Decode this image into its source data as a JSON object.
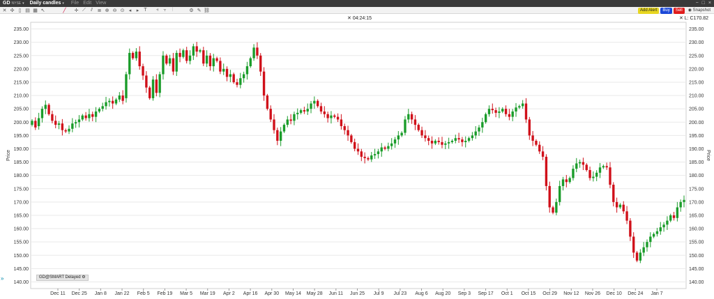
{
  "window": {
    "symbol": "GD",
    "exchange": "NYSE",
    "period": "Daily candles",
    "menus": [
      "File",
      "Edit",
      "View"
    ],
    "controls": [
      "−",
      "□",
      "×"
    ]
  },
  "toolbar": {
    "add_alert": "Add Alert",
    "buy": "Buy",
    "sell": "Sell",
    "snapshot": "Snapshot"
  },
  "overlay": {
    "cursor_time": "04:24:15",
    "last_price": "L: C170.82",
    "datasource": "GD@SMART Delayed"
  },
  "colors": {
    "up": "#1a9c2a",
    "down": "#d0101a",
    "grid": "#e9e9e9",
    "axis_text": "#333333"
  },
  "chart_data": {
    "type": "candlestick",
    "ylabel": "Price",
    "ylim": [
      137.5,
      237.5
    ],
    "yticks": [
      "140.00",
      "145.00",
      "150.00",
      "155.00",
      "160.00",
      "165.00",
      "170.00",
      "175.00",
      "180.00",
      "185.00",
      "190.00",
      "195.00",
      "200.00",
      "205.00",
      "210.00",
      "215.00",
      "220.00",
      "225.00",
      "230.00",
      "235.00"
    ],
    "xticks": [
      "Dec 11",
      "Dec 25",
      "Jan 8",
      "Jan 22",
      "Feb 5",
      "Feb 19",
      "Mar 5",
      "Mar 19",
      "Apr 2",
      "Apr 16",
      "Apr 30",
      "May 14",
      "May 28",
      "Jun 11",
      "Jun 25",
      "Jul 9",
      "Jul 23",
      "Aug 6",
      "Aug 20",
      "Sep 3",
      "Sep 17",
      "Oct 1",
      "Oct 15",
      "Oct 29",
      "Nov 12",
      "Nov 26",
      "Dec 10",
      "Dec 24",
      "Jan 7"
    ],
    "closes": [
      200.5,
      198.0,
      201.5,
      205.0,
      206.5,
      203.0,
      200.5,
      199.0,
      199.5,
      197.0,
      196.5,
      197.5,
      199.5,
      200.0,
      201.0,
      202.5,
      201.5,
      203.0,
      202.0,
      204.0,
      205.0,
      206.0,
      207.5,
      208.0,
      207.0,
      208.5,
      210.0,
      208.0,
      218.0,
      226.0,
      224.0,
      226.5,
      221.0,
      217.5,
      213.0,
      209.0,
      216.0,
      211.0,
      218.0,
      225.0,
      222.0,
      224.0,
      219.0,
      226.0,
      224.5,
      227.0,
      223.0,
      225.0,
      228.5,
      226.5,
      227.0,
      222.0,
      225.0,
      221.0,
      224.0,
      223.0,
      219.0,
      220.0,
      217.0,
      218.0,
      215.0,
      214.0,
      216.5,
      218.0,
      221.0,
      224.0,
      228.0,
      225.0,
      219.0,
      210.0,
      205.0,
      201.0,
      197.0,
      193.0,
      196.5,
      199.0,
      201.0,
      200.5,
      203.0,
      203.5,
      204.5,
      204.0,
      205.0,
      207.0,
      208.0,
      206.0,
      204.0,
      203.0,
      201.5,
      202.5,
      202.0,
      201.0,
      198.5,
      197.0,
      195.0,
      192.5,
      190.0,
      189.0,
      187.0,
      186.5,
      186.0,
      187.5,
      188.0,
      189.0,
      190.5,
      190.0,
      191.0,
      192.0,
      193.5,
      195.0,
      196.0,
      201.0,
      203.0,
      201.0,
      199.0,
      197.0,
      195.0,
      194.0,
      193.0,
      192.0,
      193.0,
      192.5,
      191.5,
      192.0,
      192.5,
      193.0,
      194.0,
      193.5,
      192.5,
      193.0,
      194.0,
      195.0,
      196.5,
      198.0,
      200.0,
      203.0,
      205.0,
      204.5,
      203.5,
      204.0,
      205.0,
      203.0,
      202.0,
      204.0,
      205.5,
      206.0,
      207.0,
      201.0,
      195.0,
      193.0,
      191.5,
      189.0,
      187.0,
      176.0,
      168.0,
      166.0,
      170.0,
      176.0,
      178.5,
      177.5,
      179.0,
      182.5,
      184.5,
      185.0,
      184.0,
      182.0,
      179.0,
      179.5,
      181.0,
      183.0,
      183.5,
      183.0,
      176.5,
      170.0,
      168.0,
      169.0,
      166.5,
      163.0,
      157.0,
      151.0,
      148.0,
      151.0,
      153.0,
      155.0,
      157.0,
      158.0,
      159.0,
      160.5,
      161.5,
      163.0,
      165.0,
      164.0,
      168.0,
      170.0,
      170.8
    ],
    "opens": [
      199.0,
      200.5,
      198.5,
      201.5,
      205.0,
      206.5,
      203.0,
      200.5,
      199.0,
      199.5,
      197.0,
      196.5,
      197.5,
      199.5,
      200.0,
      201.0,
      202.5,
      201.5,
      203.0,
      202.0,
      204.0,
      205.0,
      206.0,
      207.5,
      208.0,
      207.0,
      208.5,
      210.0,
      209.0,
      218.0,
      226.0,
      224.0,
      226.5,
      221.0,
      217.5,
      213.0,
      209.0,
      216.0,
      211.0,
      218.0,
      225.0,
      222.0,
      224.0,
      219.0,
      226.0,
      224.5,
      227.0,
      223.0,
      225.0,
      228.5,
      226.5,
      227.0,
      222.0,
      225.0,
      221.0,
      224.0,
      223.0,
      219.0,
      220.0,
      217.0,
      218.0,
      215.0,
      214.0,
      216.5,
      218.0,
      221.0,
      224.0,
      228.0,
      225.0,
      219.0,
      210.0,
      205.0,
      201.0,
      197.0,
      193.0,
      196.5,
      199.0,
      201.0,
      200.5,
      203.0,
      203.5,
      204.5,
      204.0,
      205.0,
      207.0,
      208.0,
      206.0,
      204.0,
      203.0,
      201.5,
      202.5,
      202.0,
      201.0,
      198.5,
      197.0,
      195.0,
      192.5,
      190.0,
      189.0,
      187.0,
      186.5,
      186.0,
      187.5,
      188.0,
      189.0,
      190.5,
      190.0,
      191.0,
      192.0,
      193.5,
      195.0,
      196.0,
      201.0,
      203.0,
      201.0,
      199.0,
      197.0,
      195.0,
      194.0,
      193.0,
      192.0,
      193.0,
      192.5,
      191.5,
      192.0,
      192.5,
      193.0,
      194.0,
      193.5,
      192.5,
      193.0,
      194.0,
      195.0,
      196.5,
      198.0,
      200.0,
      203.0,
      205.0,
      204.5,
      203.5,
      204.0,
      205.0,
      203.0,
      202.0,
      204.0,
      205.5,
      206.0,
      207.0,
      201.0,
      195.0,
      193.0,
      191.5,
      189.0,
      187.0,
      176.0,
      168.0,
      166.0,
      170.0,
      176.0,
      178.5,
      177.5,
      179.0,
      182.5,
      184.5,
      185.0,
      184.0,
      182.0,
      179.0,
      179.5,
      181.0,
      183.0,
      183.5,
      183.0,
      176.5,
      170.0,
      168.0,
      169.0,
      166.5,
      163.0,
      157.0,
      151.0,
      148.0,
      151.0,
      153.0,
      155.0,
      157.0,
      158.0,
      159.0,
      160.5,
      161.5,
      163.0,
      165.0,
      164.0,
      168.0,
      170.0
    ]
  }
}
